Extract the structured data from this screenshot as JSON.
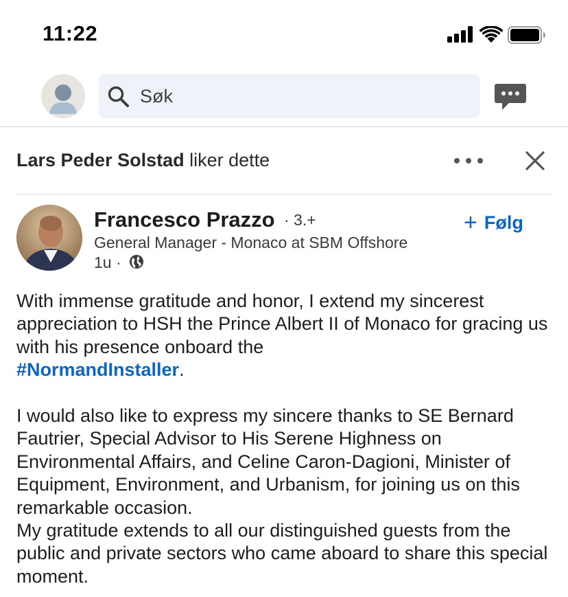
{
  "status_bar": {
    "time": "11:22"
  },
  "header": {
    "search_placeholder": "Søk"
  },
  "activity": {
    "actor": "Lars Peder Solstad",
    "action": "liker dette"
  },
  "post": {
    "author_name": "Francesco Prazzo",
    "degree": "· 3.+",
    "headline": "General Manager - Monaco at SBM Offshore",
    "time": "1u ·",
    "follow_label": "Følg",
    "follow_plus": "+",
    "para1_a": "With immense gratitude and honor, I extend my sincerest appreciation to HSH the Prince Albert II of Monaco for gracing us with his presence onboard the",
    "hashtag": "#NormandInstaller",
    "para1_end": ".",
    "para2": "I would also like to express my sincere thanks to SE Bernard Fautrier, Special Advisor to His Serene Highness on Environmental Affairs, and Celine Caron-Dagioni, Minister of Equipment, Environment, and Urbanism, for joining us on this remarkable occasion.",
    "para3": "My gratitude extends to all our distinguished guests from the public and private sectors who came aboard to share this special moment."
  },
  "colors": {
    "link_blue": "#0a66c2",
    "search_bg": "#edf3f8"
  },
  "icons": [
    "signal-icon",
    "wifi-icon",
    "battery-icon",
    "search-icon",
    "messaging-icon",
    "more-icon",
    "close-icon",
    "globe-icon"
  ]
}
